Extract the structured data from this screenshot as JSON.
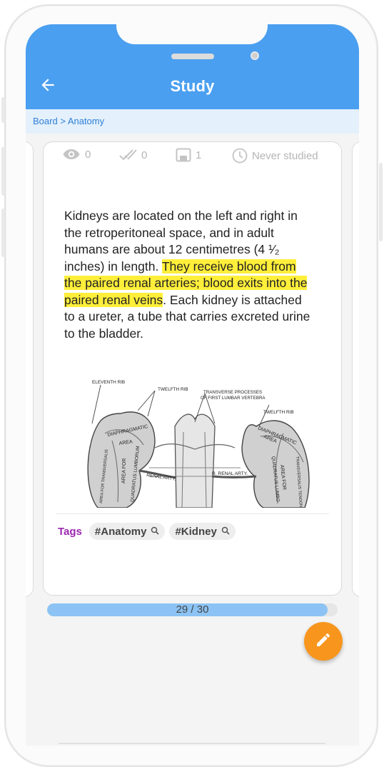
{
  "app_bar": {
    "title": "Study",
    "back_icon": "arrow-left-icon"
  },
  "breadcrumb": {
    "items": [
      "Board",
      "Anatomy"
    ],
    "separator": " > "
  },
  "stats": {
    "views": "0",
    "correct": "0",
    "cards": "1",
    "last_studied": "Never studied"
  },
  "card": {
    "text_part1": "Kidneys are located on the left and right in the retroperitoneal space, and in adult humans are about 12 centimetres (4 ¹⁄₂ inches) in length. ",
    "text_highlight": "They receive blood from the paired renal arteries; blood exits into the paired renal veins",
    "text_part2": ". Each kidney is attached to a ureter, a tube that carries excreted urine to the bladder.",
    "figure_labels": {
      "eleventh_rib": "ELEVENTH RIB",
      "twelfth_rib_left": "TWELFTH RIB",
      "transverse": "TRANSVERSE PROCESSES",
      "transverse2": "OF FIRST LUMBAR VERTEBRA",
      "twelfth_rib_right": "TWELFTH RIB",
      "diaphragmatic_left": "DIAPHRAGMATIC",
      "area_left": "AREA",
      "renal_arty_left": "RENAL ARTY.",
      "renal_arty_right": "R. RENAL ARTY.",
      "area_for_left": "AREA FOR",
      "quadratus_left": "QUADRATUS LUMBORUM",
      "transversalis_left": "AREA FOR TRANSVERSALIS",
      "diaphragmatic_right": "DIAPHRAGMATIC",
      "area_right": "AREA",
      "area_for_right": "AREA FOR",
      "quadratus_right": "QUADRATUS LUMBO",
      "transversalis_right": "TRANSVERSALIS TENDON"
    }
  },
  "tags": {
    "label": "Tags",
    "items": [
      "#Anatomy",
      "#Kidney"
    ]
  },
  "progress": {
    "label": "29 / 30",
    "current": 29,
    "total": 30
  },
  "colors": {
    "primary": "#4a9ff0",
    "highlight": "#ffef3a",
    "fab": "#f7951d",
    "tags_label": "#9c27b0",
    "progress_fill": "#8cc3f4"
  },
  "fab": {
    "icon": "pencil-icon"
  }
}
